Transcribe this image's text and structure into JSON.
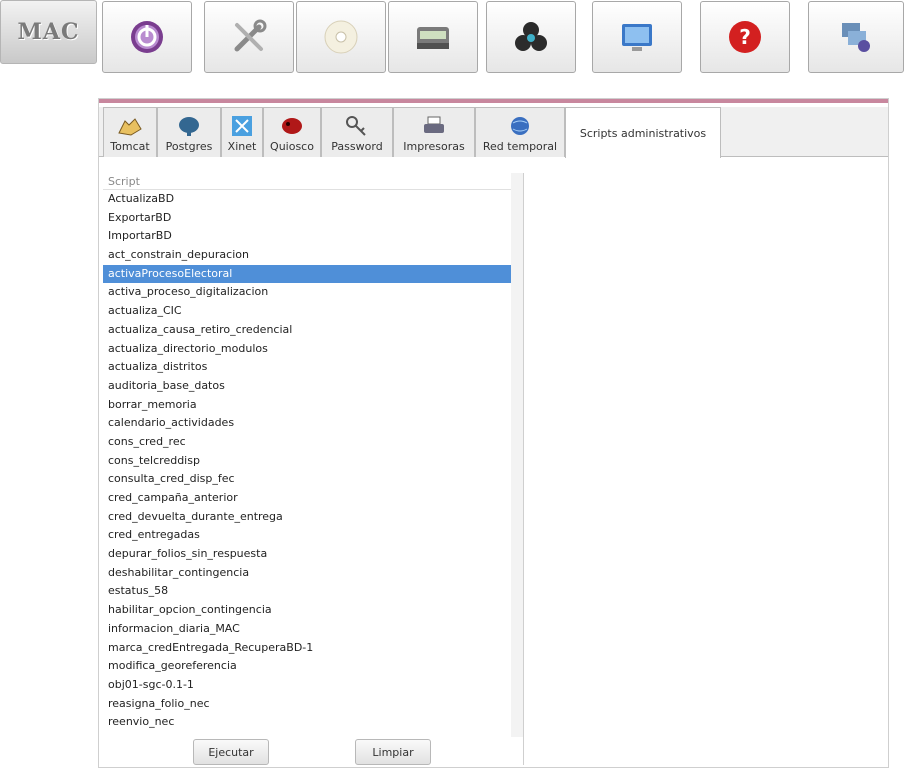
{
  "toolbar": {
    "logo_text": "MAC",
    "buttons": [
      {
        "icon": "power-icon"
      },
      {
        "icon": "tools-icon"
      },
      {
        "icon": "disc-icon"
      },
      {
        "icon": "scanner-icon"
      },
      {
        "icon": "biohazard-icon"
      },
      {
        "icon": "monitor-icon"
      },
      {
        "icon": "help-icon"
      },
      {
        "icon": "network-icon"
      }
    ]
  },
  "tabs": [
    {
      "label": "Tomcat",
      "icon": "tomcat-icon"
    },
    {
      "label": "Postgres",
      "icon": "elephant-icon"
    },
    {
      "label": "Xinet",
      "icon": "xinet-icon"
    },
    {
      "label": "Quiosco",
      "icon": "dog-icon"
    },
    {
      "label": "Password",
      "icon": "keys-icon"
    },
    {
      "label": "Impresoras",
      "icon": "printer-icon"
    },
    {
      "label": "Red temporal",
      "icon": "globe-icon"
    },
    {
      "label": "Scripts administrativos",
      "icon": ""
    }
  ],
  "script_list": {
    "header": "Script",
    "selected": "activaProcesoElectoral",
    "items": [
      "ActualizaBD",
      "ExportarBD",
      "ImportarBD",
      "act_constrain_depuracion",
      "activaProcesoElectoral",
      "activa_proceso_digitalizacion",
      "actualiza_CIC",
      "actualiza_causa_retiro_credencial",
      "actualiza_directorio_modulos",
      "actualiza_distritos",
      "auditoria_base_datos",
      "borrar_memoria",
      "calendario_actividades",
      "cons_cred_rec",
      "cons_telcreddisp",
      "consulta_cred_disp_fec",
      "cred_campaña_anterior",
      "cred_devuelta_durante_entrega",
      "cred_entregadas",
      "depurar_folios_sin_respuesta",
      "deshabilitar_contingencia",
      "estatus_58",
      "habilitar_opcion_contingencia",
      "informacion_diaria_MAC",
      "marca_credEntregada_RecuperaBD-1",
      "modifica_georeferencia",
      "obj01-sgc-0.1-1",
      "reasigna_folio_nec",
      "reenvio_nec"
    ]
  },
  "actions": {
    "run_label": "Ejecutar",
    "clear_label": "Limpiar"
  },
  "colors": {
    "selection": "#4f8fd8",
    "accent_bar": "#c8879e"
  }
}
